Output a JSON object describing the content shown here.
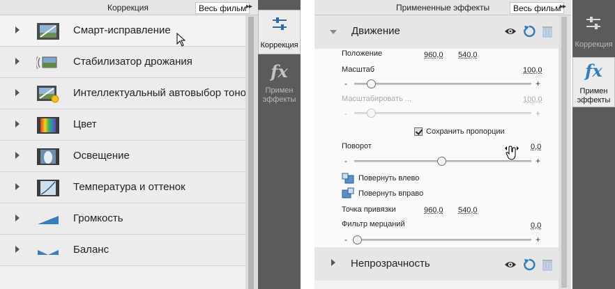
{
  "left_panel": {
    "header_title": "Коррекция",
    "film_button": "Весь фильм",
    "expand_arrows": "▸▸",
    "adjustments": [
      {
        "label": "Смарт-исправление",
        "icon": "smart-fix-icon"
      },
      {
        "label": "Стабилизатор дрожания",
        "icon": "shake-stabilizer-icon"
      },
      {
        "label": "Интеллектуальный автовыбор тонов",
        "icon": "smart-tone-icon"
      },
      {
        "label": "Цвет",
        "icon": "color-icon"
      },
      {
        "label": "Освещение",
        "icon": "lighting-icon"
      },
      {
        "label": "Температура и оттенок",
        "icon": "temperature-tint-icon"
      },
      {
        "label": "Громкость",
        "icon": "volume-icon"
      },
      {
        "label": "Баланс",
        "icon": "balance-icon"
      }
    ],
    "tabs": [
      {
        "label": "Коррекция",
        "icon": "adjustments-sliders-icon",
        "active": true
      },
      {
        "label": "Примен эффекты",
        "icon": "fx-icon",
        "active": false
      }
    ]
  },
  "right_panel": {
    "header_title": "Примененные эффекты",
    "film_button": "Весь фильм",
    "expand_arrows": "▸▸",
    "motion": {
      "title": "Движение",
      "position": {
        "label": "Положение",
        "x": "960,0",
        "y": "540,0"
      },
      "scale": {
        "label": "Масштаб",
        "value": "100,0",
        "slider_fraction": 0.1
      },
      "scale_width": {
        "label": "Масштабировать ...",
        "value": "100,0",
        "slider_fraction": 0.1,
        "disabled": true
      },
      "keep_proportions": {
        "label": "Сохранить пропорции",
        "checked": true
      },
      "rotation": {
        "label": "Поворот",
        "value": "0,0",
        "slider_fraction": 0.5
      },
      "rotate_left": "Повернуть влево",
      "rotate_right": "Повернуть вправо",
      "anchor": {
        "label": "Точка привязки",
        "x": "960,0",
        "y": "540,0"
      },
      "flicker": {
        "label": "Фильтр мерцаний",
        "value": "0,0",
        "slider_fraction": 0.0
      },
      "minus": "-",
      "plus": "+"
    },
    "opacity": {
      "title": "Непрозрачность"
    },
    "tabs": [
      {
        "label": "Коррекция",
        "icon": "adjustments-sliders-icon",
        "active": false
      },
      {
        "label": "Примен эффекты",
        "icon": "fx-icon",
        "active": true
      }
    ]
  },
  "colors": {
    "accent_blue": "#2f7fc4",
    "tab_strip": "#5b5b5b",
    "panel_bg": "#ececec"
  }
}
